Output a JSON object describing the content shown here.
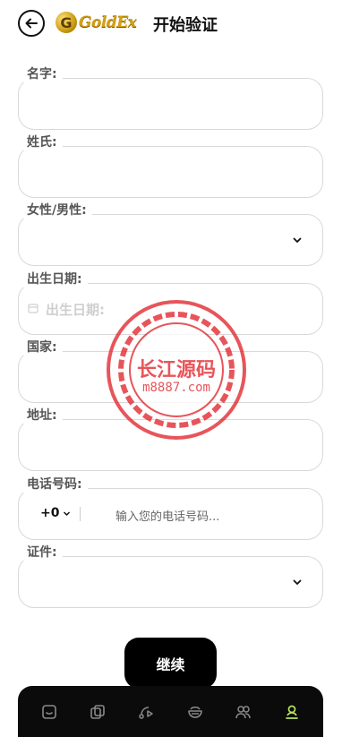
{
  "header": {
    "title": "开始验证",
    "logo_text": "GoldEx",
    "logo_letter": "G"
  },
  "form": {
    "first_name_label": "名字:",
    "last_name_label": "姓氏:",
    "gender_label": "女性/男性:",
    "dob_label": "出生日期:",
    "dob_placeholder": "出生日期:",
    "country_label": "国家:",
    "address_label": "地址:",
    "phone_label": "电话号码:",
    "country_code": "+0",
    "phone_placeholder": "输入您的电话号码...",
    "id_label": "证件:"
  },
  "continue_label": "继续",
  "watermark": {
    "line1": "长江源码",
    "line2": "m8887.com"
  },
  "bottom_nav": {
    "items": [
      "home-icon",
      "copy-icon",
      "route-icon",
      "bowl-icon",
      "team-icon",
      "profile-icon"
    ],
    "active_index": 5,
    "active_color": "#b6e35a"
  }
}
